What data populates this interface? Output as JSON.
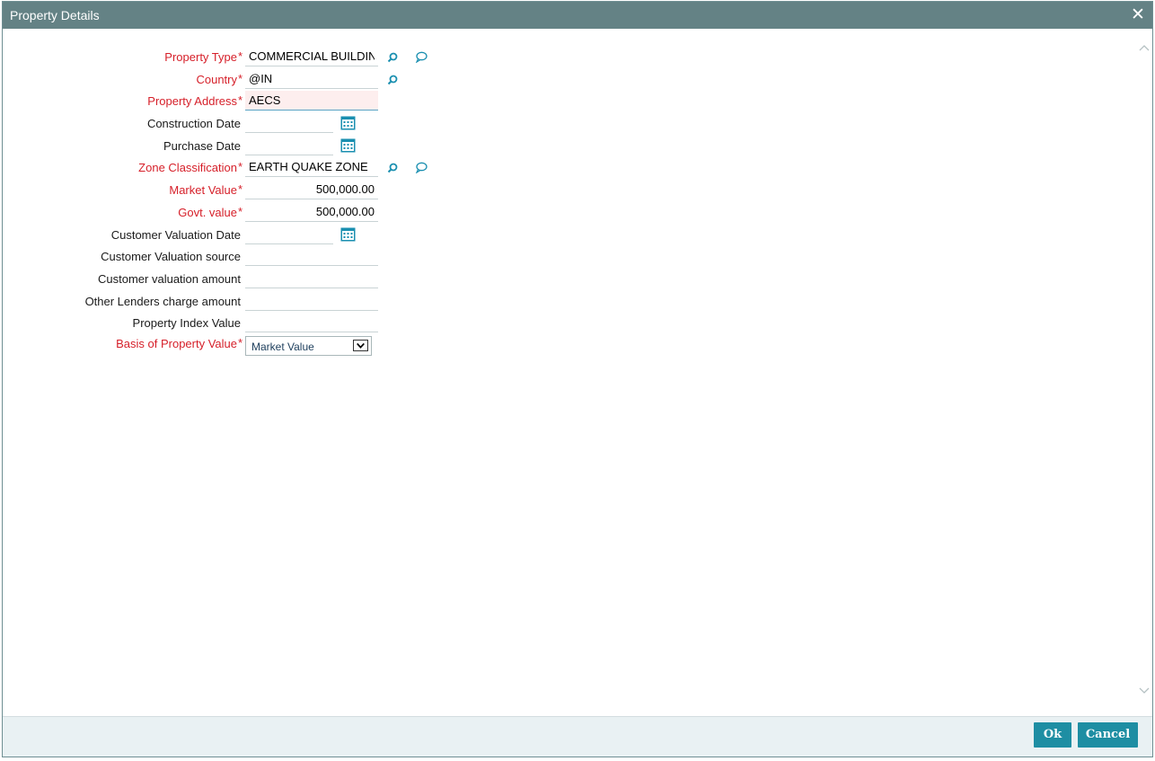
{
  "window": {
    "title": "Property Details"
  },
  "form": {
    "property_type": {
      "label": "Property Type",
      "value": "COMMERCIAL BUILDIN"
    },
    "country": {
      "label": "Country",
      "value": "@IN"
    },
    "property_address": {
      "label": "Property Address",
      "value": "AECS"
    },
    "construction_date": {
      "label": "Construction Date",
      "value": ""
    },
    "purchase_date": {
      "label": "Purchase Date",
      "value": ""
    },
    "zone_classification": {
      "label": "Zone Classification",
      "value": "EARTH QUAKE ZONE"
    },
    "market_value": {
      "label": "Market Value",
      "value": "500,000.00"
    },
    "govt_value": {
      "label": "Govt. value",
      "value": "500,000.00"
    },
    "customer_valuation_date": {
      "label": "Customer Valuation Date",
      "value": ""
    },
    "customer_valuation_source": {
      "label": "Customer Valuation source",
      "value": ""
    },
    "customer_valuation_amount": {
      "label": "Customer valuation amount",
      "value": ""
    },
    "other_lenders_charge_amount": {
      "label": "Other Lenders charge amount",
      "value": ""
    },
    "property_index_value": {
      "label": "Property Index Value",
      "value": ""
    },
    "basis_of_property_value": {
      "label": "Basis of Property Value",
      "value": "Market Value"
    },
    "required_marker": "*"
  },
  "footer": {
    "ok_label": "Ok",
    "cancel_label": "Cancel"
  },
  "icons": {
    "close": "close-icon",
    "lov": "search-icon",
    "description": "speech-bubble-icon",
    "calendar": "calendar-icon"
  },
  "colors": {
    "titlebar": "#648285",
    "required_label": "#d6202a",
    "icon": "#1a8fb0",
    "button": "#1e8ea3",
    "footer": "#e9f1f3"
  }
}
